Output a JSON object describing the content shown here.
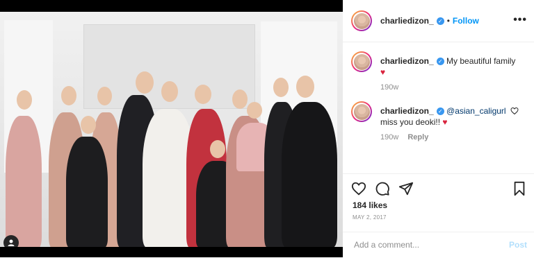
{
  "post": {
    "username": "charliedizon_",
    "follow_label": "Follow",
    "dot": "•",
    "more_label": "•••"
  },
  "comments": [
    {
      "username": "charliedizon_",
      "text": "My beautiful family",
      "emoji": "♥",
      "time": "190w"
    },
    {
      "username": "charliedizon_",
      "mention": "@asian_caligurl",
      "text": "miss you deoki!!",
      "emoji": "♥",
      "time": "190w",
      "reply_label": "Reply"
    }
  ],
  "actions": {
    "likes": "184 likes",
    "date": "MAY 2, 2017"
  },
  "comment_box": {
    "placeholder": "Add a comment...",
    "post_label": "Post"
  },
  "colors": {
    "accent": "#0095f6",
    "verified": "#3897f0",
    "heart": "#d9233d"
  }
}
